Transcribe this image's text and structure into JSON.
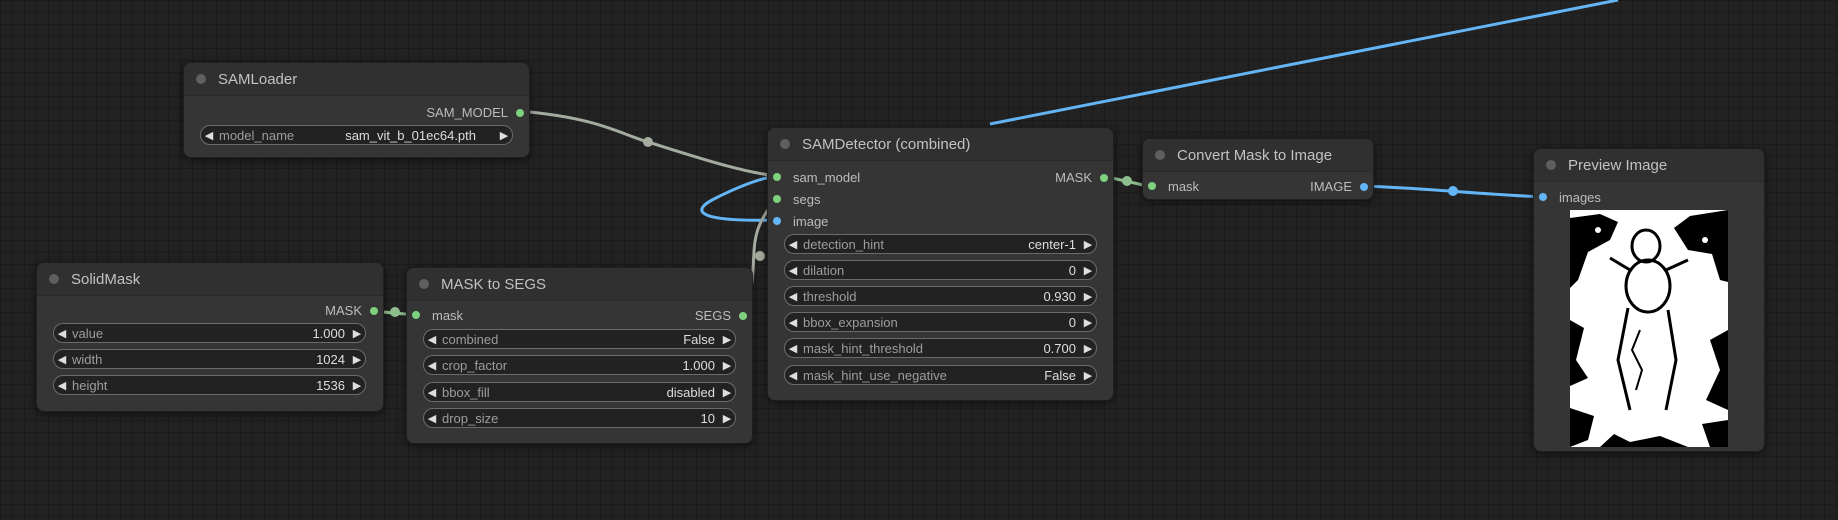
{
  "colors": {
    "mask_link": "#8fbf8f",
    "sam_link": "#a4ab9f",
    "image_link": "#64b5f6",
    "mask_slot": "#7fd07f",
    "image_slot": "#64b5f6",
    "node_bg": "#353535"
  },
  "nodes": {
    "sam_loader": {
      "title": "SAMLoader",
      "output": "SAM_MODEL",
      "widgets": [
        {
          "name": "model_name",
          "value": "sam_vit_b_01ec64.pth"
        }
      ]
    },
    "solid_mask": {
      "title": "SolidMask",
      "output": "MASK",
      "widgets": [
        {
          "name": "value",
          "value": "1.000"
        },
        {
          "name": "width",
          "value": "1024"
        },
        {
          "name": "height",
          "value": "1536"
        }
      ]
    },
    "mask_to_segs": {
      "title": "MASK to SEGS",
      "input": "mask",
      "output": "SEGS",
      "widgets": [
        {
          "name": "combined",
          "value": "False"
        },
        {
          "name": "crop_factor",
          "value": "1.000"
        },
        {
          "name": "bbox_fill",
          "value": "disabled"
        },
        {
          "name": "drop_size",
          "value": "10"
        }
      ]
    },
    "sam_detector": {
      "title": "SAMDetector (combined)",
      "inputs": [
        "sam_model",
        "segs",
        "image"
      ],
      "output": "MASK",
      "widgets": [
        {
          "name": "detection_hint",
          "value": "center-1"
        },
        {
          "name": "dilation",
          "value": "0"
        },
        {
          "name": "threshold",
          "value": "0.930"
        },
        {
          "name": "bbox_expansion",
          "value": "0"
        },
        {
          "name": "mask_hint_threshold",
          "value": "0.700"
        },
        {
          "name": "mask_hint_use_negative",
          "value": "False"
        }
      ]
    },
    "convert_mask": {
      "title": "Convert Mask to Image",
      "input": "mask",
      "output": "IMAGE"
    },
    "preview_image": {
      "title": "Preview Image",
      "input": "images"
    }
  },
  "icons": {
    "left_arrow": "◀",
    "right_arrow": "▶"
  }
}
